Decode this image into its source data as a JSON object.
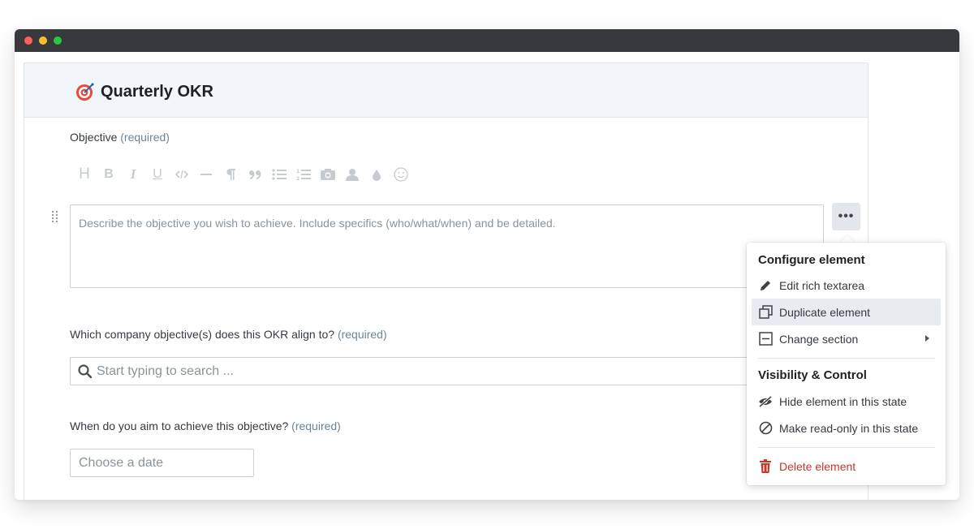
{
  "form": {
    "title": "Quarterly OKR",
    "objective": {
      "label": "Objective",
      "required": "(required)",
      "placeholder": "Describe the objective you wish to achieve. Include specifics (who/what/when) and be detailed."
    },
    "alignment": {
      "label": "Which company objective(s) does this OKR align to?",
      "required": "(required)",
      "placeholder": "Start typing to search ..."
    },
    "date": {
      "label": "When do you aim to achieve this objective?",
      "required": "(required)",
      "placeholder": "Choose a date"
    },
    "toolbar_icons": [
      "heading-icon",
      "bold-icon",
      "italic-icon",
      "underline-icon",
      "code-icon",
      "horizontal-rule-icon",
      "paragraph-icon",
      "quote-icon",
      "bullet-list-icon",
      "numbered-list-icon",
      "image-icon",
      "user-mention-icon",
      "color-drop-icon",
      "emoji-icon"
    ],
    "toolbar_letters": {
      "heading": "H",
      "bold": "B",
      "italic": "I",
      "underline": "U"
    },
    "more_label": "•••"
  },
  "menu": {
    "configure_heading": "Configure element",
    "edit_label": "Edit rich textarea",
    "duplicate_label": "Duplicate element",
    "change_section_label": "Change section",
    "visibility_heading": "Visibility & Control",
    "hide_label": "Hide element in this state",
    "readonly_label": "Make read-only in this state",
    "delete_label": "Delete element"
  },
  "colors": {
    "accent_required": "#6b8596",
    "danger": "#c0392b",
    "header_bg": "#f1f6fa"
  }
}
